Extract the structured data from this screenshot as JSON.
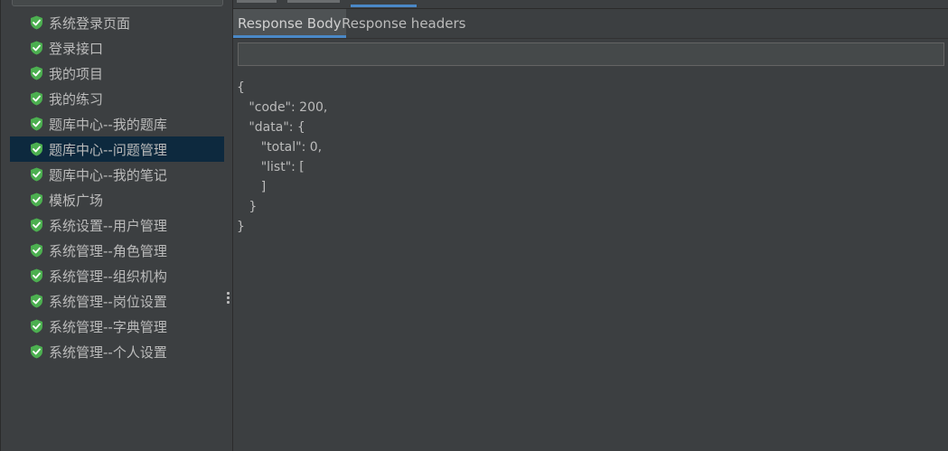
{
  "sidebar": {
    "items": [
      {
        "label": "系统登录页面",
        "status": "success"
      },
      {
        "label": "登录接口",
        "status": "success"
      },
      {
        "label": "我的项目",
        "status": "success"
      },
      {
        "label": "我的练习",
        "status": "success"
      },
      {
        "label": "题库中心--我的题库",
        "status": "success"
      },
      {
        "label": "题库中心--问题管理",
        "status": "success",
        "selected": true
      },
      {
        "label": "题库中心--我的笔记",
        "status": "success"
      },
      {
        "label": "模板广场",
        "status": "success"
      },
      {
        "label": "系统设置--用户管理",
        "status": "success"
      },
      {
        "label": "系统管理--角色管理",
        "status": "success"
      },
      {
        "label": "系统管理--组织机构",
        "status": "success"
      },
      {
        "label": "系统管理--岗位设置",
        "status": "success"
      },
      {
        "label": "系统管理--字典管理",
        "status": "success"
      },
      {
        "label": "系统管理--个人设置",
        "status": "success"
      }
    ]
  },
  "tabs": {
    "response_body": "Response Body",
    "response_headers": "Response headers"
  },
  "search": {
    "value": ""
  },
  "response": {
    "lines": [
      "{",
      "   \"code\": 200,",
      "   \"data\": {",
      "      \"total\": 0,",
      "      \"list\": [",
      "      ]",
      "   }",
      "}"
    ]
  },
  "colors": {
    "background": "#3c3f41",
    "selection": "#0d293e",
    "accent": "#4a88c7",
    "success_check": "#4caf50",
    "text": "#bbbbbb"
  },
  "icons": {
    "tree_item_status": "success-check-shield-icon",
    "splitter": "drag-handle-icon"
  }
}
